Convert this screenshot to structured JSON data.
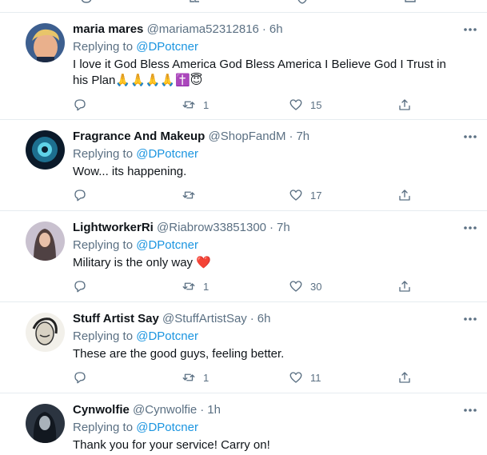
{
  "reply_prefix": "Replying to ",
  "separator": "·",
  "tweets": [
    {
      "name": "maria mares",
      "handle": "@mariama52312816",
      "time": "6h",
      "reply_to": "@DPotcner",
      "text": "I love it God Bless America God Bless America I Believe God I Trust in his Plan🙏🙏🙏🙏✝️😇",
      "replies": "",
      "retweets": "1",
      "likes": "15"
    },
    {
      "name": "Fragrance And Makeup",
      "handle": "@ShopFandM",
      "time": "7h",
      "reply_to": "@DPotcner",
      "text": "Wow... its happening.",
      "replies": "",
      "retweets": "",
      "likes": "17"
    },
    {
      "name": "LightworkerRi",
      "handle": "@Riabrow33851300",
      "time": "7h",
      "reply_to": "@DPotcner",
      "text": "Military is the only way ❤️",
      "replies": "",
      "retweets": "1",
      "likes": "30"
    },
    {
      "name": "Stuff Artist Say",
      "handle": "@StuffArtistSay",
      "time": "6h",
      "reply_to": "@DPotcner",
      "text": "These are the good guys, feeling better.",
      "replies": "",
      "retweets": "1",
      "likes": "11"
    },
    {
      "name": "Cynwolfie",
      "handle": "@Cynwolfie",
      "time": "1h",
      "reply_to": "@DPotcner",
      "text": "Thank you for your service! Carry on!",
      "replies": "",
      "retweets": "",
      "likes": ""
    }
  ],
  "icons": {
    "reply": "comment-icon",
    "retweet": "retweet-icon",
    "like": "heart-icon",
    "share": "share-icon",
    "more": "more-options-icon"
  },
  "colors": {
    "text": "#0f1419",
    "secondary": "#5b7083",
    "mention": "#1b95e0",
    "divider": "#e6ecf0"
  }
}
